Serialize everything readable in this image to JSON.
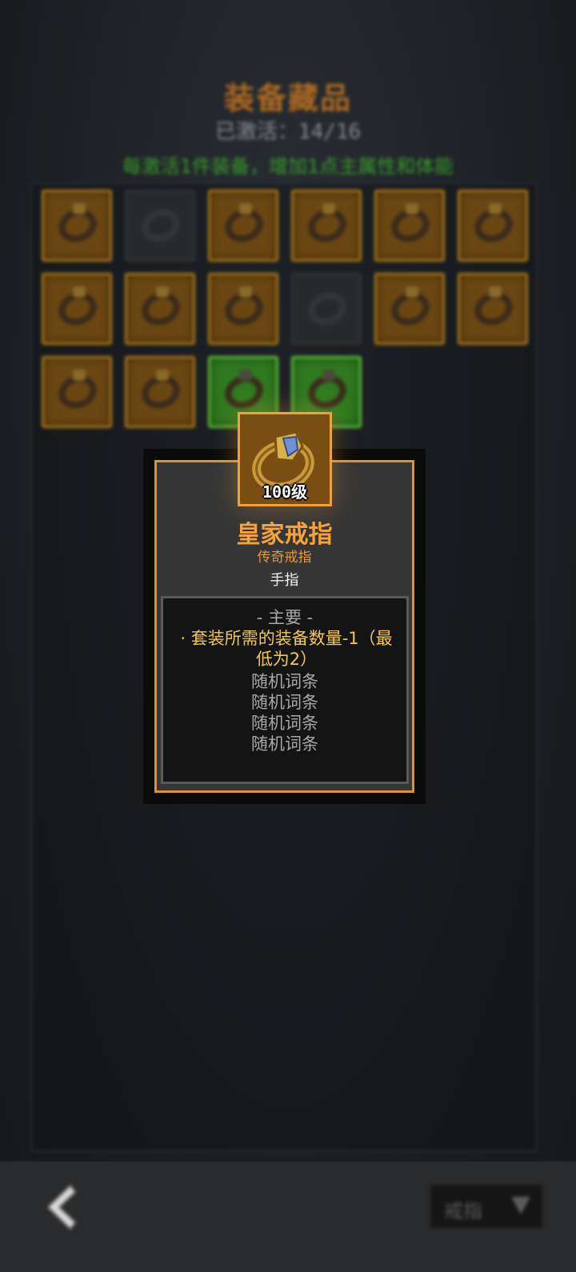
{
  "header": {
    "title": "装备藏品",
    "collected": "已激活：14/16",
    "hint": "每激活1件装备，增加1点主属性和体能"
  },
  "grid": {
    "slots": [
      {
        "state": "gold",
        "ring": "gold-ruby-ring"
      },
      {
        "state": "empty",
        "ring": "locked-ring"
      },
      {
        "state": "gold",
        "ring": "antler-ring"
      },
      {
        "state": "gold",
        "ring": "gold-sapphire-ring"
      },
      {
        "state": "gold",
        "ring": "gold-signet-ring"
      },
      {
        "state": "gold",
        "ring": "spiked-dark-ring"
      },
      {
        "state": "gold",
        "ring": "silver-black-ring"
      },
      {
        "state": "gold",
        "ring": "red-stone-ring"
      },
      {
        "state": "gold",
        "ring": "silver-band-ring"
      },
      {
        "state": "empty",
        "ring": "locked-ring"
      },
      {
        "state": "gold",
        "ring": "crimson-ring"
      },
      {
        "state": "gold",
        "ring": "teal-stone-ring"
      },
      {
        "state": "gold",
        "ring": "purple-crystal-ring"
      },
      {
        "state": "gold",
        "ring": "leaf-ring"
      },
      {
        "state": "green",
        "ring": "ruby-band-ring"
      },
      {
        "state": "green",
        "ring": "bronze-band-ring"
      }
    ]
  },
  "tooltip": {
    "level": "100级",
    "name": "皇家戒指",
    "rarity": "传奇戒指",
    "slot": "手指",
    "section_header": "- 主要 -",
    "main_affix": "· 套装所需的装备数量-1（最低为2）",
    "random_affixes": [
      "随机词条",
      "随机词条",
      "随机词条",
      "随机词条"
    ]
  },
  "footer": {
    "filter_value": "戒指"
  },
  "colors": {
    "legendary": "#f4a33c",
    "affix": "#f4c94a",
    "green_slot": "#5fbe3b"
  }
}
